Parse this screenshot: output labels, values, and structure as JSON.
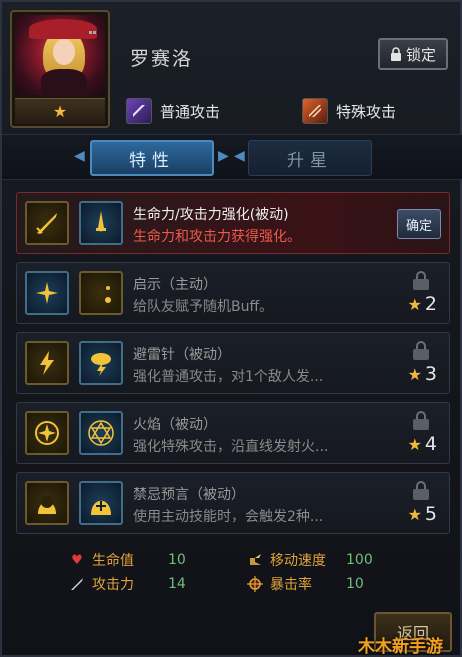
{
  "hero": {
    "name": "罗赛洛",
    "stars": "★"
  },
  "header": {
    "lock_label": "锁定",
    "lock_icon": "lock-icon"
  },
  "attacks": {
    "normal_label": "普通攻击",
    "special_label": "特殊攻击"
  },
  "tabs": [
    {
      "label": "特性",
      "active": true
    },
    {
      "label": "升星",
      "active": false
    }
  ],
  "skills": [
    {
      "name": "生命力/攻击力强化(被动)",
      "desc": "生命力和攻击力获得强化。",
      "action_label": "确定",
      "state": "active"
    },
    {
      "name": "启示（主动）",
      "desc": "给队友赋予随机Buff。",
      "required_stars": "2",
      "state": "locked"
    },
    {
      "name": "避雷针（被动）",
      "desc": "强化普通攻击，对1个敌人发...",
      "required_stars": "3",
      "state": "locked"
    },
    {
      "name": "火焰（被动）",
      "desc": "强化特殊攻击，沿直线发射火...",
      "required_stars": "4",
      "state": "locked"
    },
    {
      "name": "禁忌预言（被动）",
      "desc": "使用主动技能时，会触发2种...",
      "required_stars": "5",
      "state": "locked"
    }
  ],
  "stats": {
    "hp": {
      "label": "生命值",
      "value": "10"
    },
    "atk": {
      "label": "攻击力",
      "value": "14"
    },
    "speed": {
      "label": "移动速度",
      "value": "100"
    },
    "crit": {
      "label": "暴击率",
      "value": "10"
    }
  },
  "footer": {
    "return_label": "返回"
  },
  "watermark": "木木新手游",
  "colors": {
    "accent_blue": "#4c8ac0",
    "active_red": "#ec5a4a",
    "star_gold": "#f2b83a",
    "stat_label": "#e0a23a",
    "stat_value": "#6ec07a"
  }
}
